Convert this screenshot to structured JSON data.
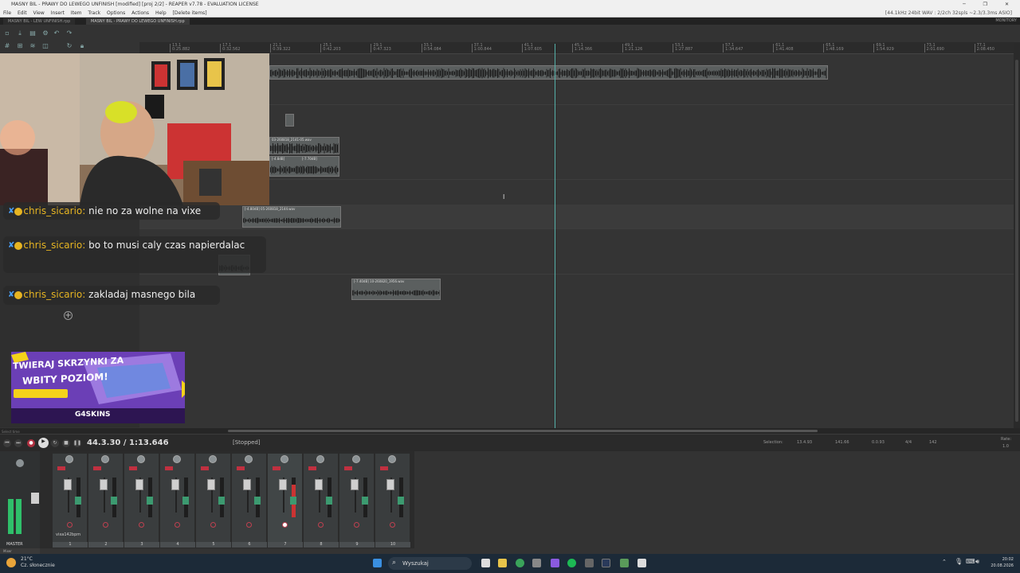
{
  "window": {
    "title": "MASNY BIL - PRAWY DO LEWEGO UNFINISH [modified] [proj 2/2] - REAPER v7.78 - EVALUATION LICENSE",
    "controls": "─ ❐ ✕"
  },
  "menu": {
    "items": [
      "File",
      "Edit",
      "View",
      "Insert",
      "Item",
      "Track",
      "Options",
      "Actions",
      "Help",
      "[Delete items]"
    ],
    "audio_status": "[44.1kHz 24bit WAV : 2/2ch 32spls ~2.3/3.3ms ASIO]"
  },
  "tabs": {
    "items": [
      "MASNY BIL - LEW UNFINISH.rpp",
      "MASNY BIL - PRAWY DO LEWEGO UNFINISH.rpp"
    ],
    "monitor": "MONITORY"
  },
  "ruler": {
    "marks": [
      {
        "bar": "13.1",
        "time": "0:25.882"
      },
      {
        "bar": "17.1",
        "time": "0:32.562"
      },
      {
        "bar": "21.1",
        "time": "0:39.322"
      },
      {
        "bar": "25.1",
        "time": "0:42.203"
      },
      {
        "bar": "29.1",
        "time": "0:47.323"
      },
      {
        "bar": "33.1",
        "time": "0:54.084"
      },
      {
        "bar": "37.1",
        "time": "1:00.844"
      },
      {
        "bar": "41.1",
        "time": "1:07.605"
      },
      {
        "bar": "45.1",
        "time": "1:14.366"
      },
      {
        "bar": "49.1",
        "time": "1:21.126"
      },
      {
        "bar": "53.1",
        "time": "1:27.887"
      },
      {
        "bar": "57.1",
        "time": "1:34.647"
      },
      {
        "bar": "61.1",
        "time": "1:41.408"
      },
      {
        "bar": "65.1",
        "time": "1:48.169"
      },
      {
        "bar": "69.1",
        "time": "1:54.929"
      },
      {
        "bar": "73.1",
        "time": "2:01.690"
      },
      {
        "bar": "77.1",
        "time": "2:08.450"
      },
      {
        "bar": "81.1",
        "time": "2:15.211"
      }
    ]
  },
  "items": {
    "track2": "03-260818_2141-05.wav",
    "track2b": "[-4.8dB]",
    "track2c": "[-7.70dB]",
    "track3": "[-4.80dB] 05-260818_2144.wav",
    "track5": "[-7.40dB] 10-260820_1956.wav"
  },
  "chat": [
    {
      "user": "chris_sicario:",
      "text": "nie no za wolne na vixe"
    },
    {
      "user": "chris_sicario:",
      "text": "bo to musi caly czas napierdalac"
    },
    {
      "user": "chris_sicario:",
      "text": "zakladaj masnego bila"
    }
  ],
  "ad": {
    "line1": "TWIERAJ SKRZYNKI ZA",
    "line2": "WBITY POZIOM!",
    "brand": "G4SKINS"
  },
  "transport": {
    "select_label": "Select time",
    "time": "44.3.30 / 1:13.646",
    "state": "[Stopped]",
    "selection_label": "Selection:",
    "sel_start": "13.4.93",
    "sel_end": "141.66",
    "sel_len": "0.0.93",
    "timesig": "4/4",
    "bpm": "142",
    "rate_label": "Rate:",
    "rate": "1.0"
  },
  "mixer": {
    "master_label": "MASTER",
    "track_name": "vixa142bpm",
    "channels": [
      "1",
      "2",
      "3",
      "4",
      "5",
      "6",
      "7",
      "8",
      "9",
      "10"
    ],
    "mixer_tab": "Mixer",
    "armed_channel_levels": [
      0.82
    ]
  },
  "taskbar": {
    "weather_temp": "21°C",
    "weather_desc": "Cz. słonecznie",
    "search_placeholder": "Wyszukaj",
    "time": "20:02",
    "date": "20.08.2026"
  },
  "colors": {
    "accent": "#55b0a8",
    "chat_user": "#e6b422",
    "ad_purple": "#6b3fb6",
    "record_red": "#c03040"
  }
}
